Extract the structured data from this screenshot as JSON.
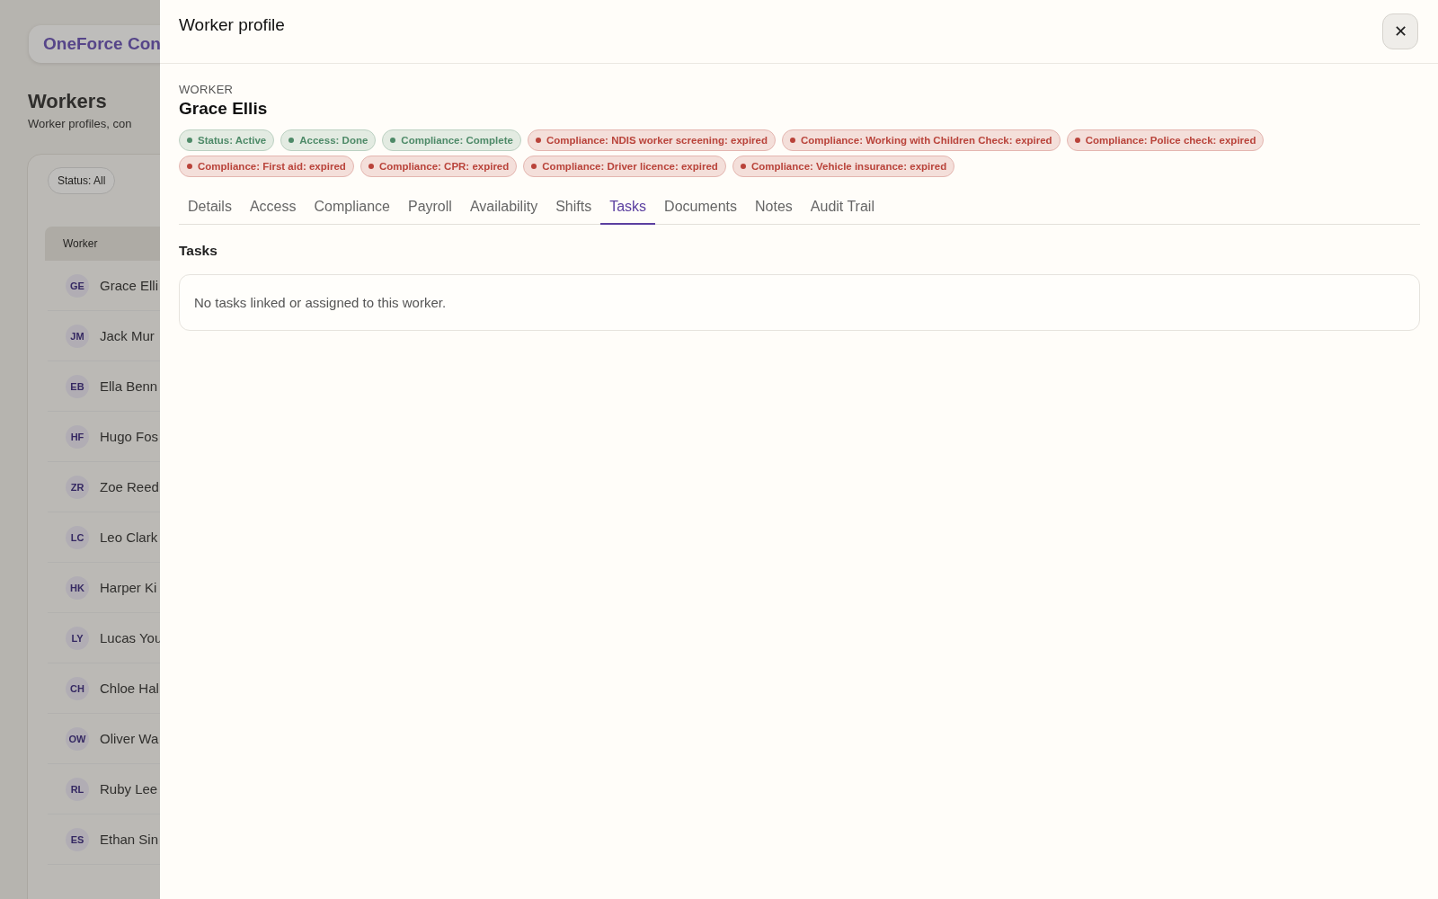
{
  "backdrop": {
    "brand": "OneForce Con",
    "title": "Workers",
    "subtitle": "Worker profiles, con",
    "filter": "Status: All",
    "column": "Worker",
    "rows": [
      {
        "initials": "GE",
        "name": "Grace Elli"
      },
      {
        "initials": "JM",
        "name": "Jack Mur"
      },
      {
        "initials": "EB",
        "name": "Ella Benn"
      },
      {
        "initials": "HF",
        "name": "Hugo Fos"
      },
      {
        "initials": "ZR",
        "name": "Zoe Reed"
      },
      {
        "initials": "LC",
        "name": "Leo Clark"
      },
      {
        "initials": "HK",
        "name": "Harper Ki"
      },
      {
        "initials": "LY",
        "name": "Lucas You"
      },
      {
        "initials": "CH",
        "name": "Chloe Hal"
      },
      {
        "initials": "OW",
        "name": "Oliver Wa"
      },
      {
        "initials": "RL",
        "name": "Ruby Lee"
      },
      {
        "initials": "ES",
        "name": "Ethan Sin"
      }
    ]
  },
  "panel": {
    "title": "Worker profile",
    "close": "✕",
    "eyebrow": "WORKER",
    "name": "Grace Ellis",
    "chips": [
      {
        "label": "Status: Active",
        "color": "#4e8a68"
      },
      {
        "label": "Access: Done",
        "color": "#4e8a68"
      },
      {
        "label": "Compliance: Complete",
        "color": "#4e8a68"
      },
      {
        "label": "Compliance: NDIS worker screening: expired",
        "color": "#b9433a"
      },
      {
        "label": "Compliance: Working with Children Check: expired",
        "color": "#b9433a"
      },
      {
        "label": "Compliance: Police check: expired",
        "color": "#b9433a"
      },
      {
        "label": "Compliance: First aid: expired",
        "color": "#b9433a"
      },
      {
        "label": "Compliance: CPR: expired",
        "color": "#b9433a"
      },
      {
        "label": "Compliance: Driver licence: expired",
        "color": "#b9433a"
      },
      {
        "label": "Compliance: Vehicle insurance: expired",
        "color": "#b9433a"
      }
    ],
    "tabs": [
      {
        "label": "Details",
        "selected": false
      },
      {
        "label": "Access",
        "selected": false
      },
      {
        "label": "Compliance",
        "selected": false
      },
      {
        "label": "Payroll",
        "selected": false
      },
      {
        "label": "Availability",
        "selected": false
      },
      {
        "label": "Shifts",
        "selected": false
      },
      {
        "label": "Tasks",
        "selected": true
      },
      {
        "label": "Documents",
        "selected": false
      },
      {
        "label": "Notes",
        "selected": false
      },
      {
        "label": "Audit Trail",
        "selected": false
      }
    ],
    "section_title": "Tasks",
    "empty_message": "No tasks linked or assigned to this worker."
  }
}
